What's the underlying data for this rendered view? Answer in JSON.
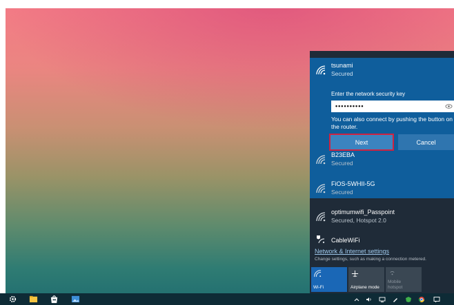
{
  "wifi_flyout": {
    "selected_network": {
      "name": "tsunami",
      "status": "Secured",
      "key_prompt": "Enter the network security key",
      "key_value_masked": "••••••••••",
      "alt_connect_line1": "You can also connect by pushing the button on",
      "alt_connect_line2": "the router.",
      "next_label": "Next",
      "cancel_label": "Cancel"
    },
    "networks": [
      {
        "name": "B23EBA",
        "status": "Secured"
      },
      {
        "name": "FiOS-5WHII-5G",
        "status": "Secured"
      },
      {
        "name": "optimumwifi_Passpoint",
        "status": "Secured, Hotspot 2.0"
      },
      {
        "name": "CableWiFi",
        "status": ""
      }
    ],
    "settings_link": "Network & Internet settings",
    "settings_desc": "Change settings, such as making a connection metered.",
    "quick_actions": [
      {
        "label": "Wi-Fi",
        "state": "on"
      },
      {
        "label": "Airplane mode",
        "state": "off"
      },
      {
        "label_line1": "Mobile",
        "label_line2": "hotspot",
        "state": "disabled"
      }
    ]
  },
  "colors": {
    "flyout_bg": "#1f2b38",
    "selected_bg": "#0f5e9c",
    "accent": "#1a67b6",
    "highlight_outline": "#d02240",
    "taskbar_bg": "#0e2b36"
  },
  "taskbar": {
    "icons": [
      "settings-gear-icon",
      "file-explorer-icon",
      "store-icon",
      "photos-icon"
    ],
    "tray": [
      "chevron-up-icon",
      "volume-icon",
      "network-icon",
      "pen-icon",
      "antivirus-icon",
      "chrome-icon",
      "notifications-icon"
    ]
  }
}
